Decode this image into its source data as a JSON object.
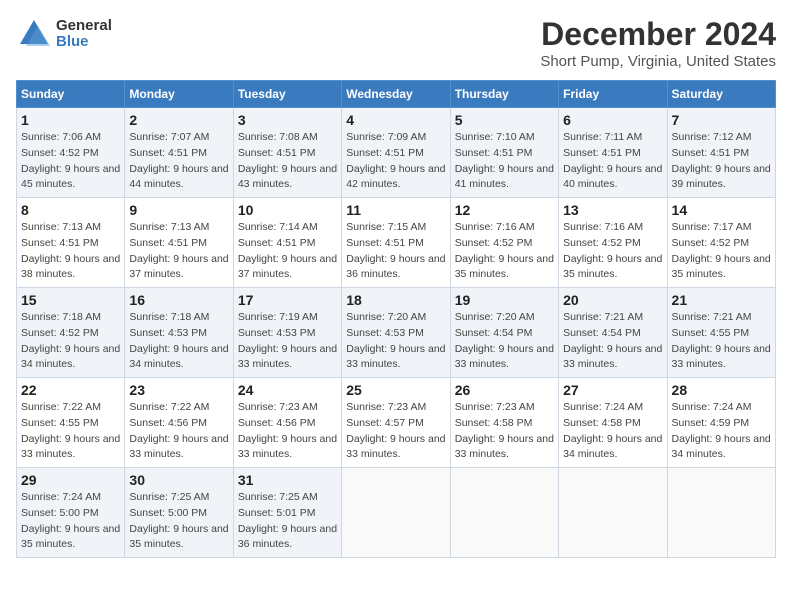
{
  "logo": {
    "general": "General",
    "blue": "Blue"
  },
  "title": "December 2024",
  "subtitle": "Short Pump, Virginia, United States",
  "days_of_week": [
    "Sunday",
    "Monday",
    "Tuesday",
    "Wednesday",
    "Thursday",
    "Friday",
    "Saturday"
  ],
  "weeks": [
    [
      {
        "day": "1",
        "sunrise": "Sunrise: 7:06 AM",
        "sunset": "Sunset: 4:52 PM",
        "daylight": "Daylight: 9 hours and 45 minutes."
      },
      {
        "day": "2",
        "sunrise": "Sunrise: 7:07 AM",
        "sunset": "Sunset: 4:51 PM",
        "daylight": "Daylight: 9 hours and 44 minutes."
      },
      {
        "day": "3",
        "sunrise": "Sunrise: 7:08 AM",
        "sunset": "Sunset: 4:51 PM",
        "daylight": "Daylight: 9 hours and 43 minutes."
      },
      {
        "day": "4",
        "sunrise": "Sunrise: 7:09 AM",
        "sunset": "Sunset: 4:51 PM",
        "daylight": "Daylight: 9 hours and 42 minutes."
      },
      {
        "day": "5",
        "sunrise": "Sunrise: 7:10 AM",
        "sunset": "Sunset: 4:51 PM",
        "daylight": "Daylight: 9 hours and 41 minutes."
      },
      {
        "day": "6",
        "sunrise": "Sunrise: 7:11 AM",
        "sunset": "Sunset: 4:51 PM",
        "daylight": "Daylight: 9 hours and 40 minutes."
      },
      {
        "day": "7",
        "sunrise": "Sunrise: 7:12 AM",
        "sunset": "Sunset: 4:51 PM",
        "daylight": "Daylight: 9 hours and 39 minutes."
      }
    ],
    [
      {
        "day": "8",
        "sunrise": "Sunrise: 7:13 AM",
        "sunset": "Sunset: 4:51 PM",
        "daylight": "Daylight: 9 hours and 38 minutes."
      },
      {
        "day": "9",
        "sunrise": "Sunrise: 7:13 AM",
        "sunset": "Sunset: 4:51 PM",
        "daylight": "Daylight: 9 hours and 37 minutes."
      },
      {
        "day": "10",
        "sunrise": "Sunrise: 7:14 AM",
        "sunset": "Sunset: 4:51 PM",
        "daylight": "Daylight: 9 hours and 37 minutes."
      },
      {
        "day": "11",
        "sunrise": "Sunrise: 7:15 AM",
        "sunset": "Sunset: 4:51 PM",
        "daylight": "Daylight: 9 hours and 36 minutes."
      },
      {
        "day": "12",
        "sunrise": "Sunrise: 7:16 AM",
        "sunset": "Sunset: 4:52 PM",
        "daylight": "Daylight: 9 hours and 35 minutes."
      },
      {
        "day": "13",
        "sunrise": "Sunrise: 7:16 AM",
        "sunset": "Sunset: 4:52 PM",
        "daylight": "Daylight: 9 hours and 35 minutes."
      },
      {
        "day": "14",
        "sunrise": "Sunrise: 7:17 AM",
        "sunset": "Sunset: 4:52 PM",
        "daylight": "Daylight: 9 hours and 35 minutes."
      }
    ],
    [
      {
        "day": "15",
        "sunrise": "Sunrise: 7:18 AM",
        "sunset": "Sunset: 4:52 PM",
        "daylight": "Daylight: 9 hours and 34 minutes."
      },
      {
        "day": "16",
        "sunrise": "Sunrise: 7:18 AM",
        "sunset": "Sunset: 4:53 PM",
        "daylight": "Daylight: 9 hours and 34 minutes."
      },
      {
        "day": "17",
        "sunrise": "Sunrise: 7:19 AM",
        "sunset": "Sunset: 4:53 PM",
        "daylight": "Daylight: 9 hours and 33 minutes."
      },
      {
        "day": "18",
        "sunrise": "Sunrise: 7:20 AM",
        "sunset": "Sunset: 4:53 PM",
        "daylight": "Daylight: 9 hours and 33 minutes."
      },
      {
        "day": "19",
        "sunrise": "Sunrise: 7:20 AM",
        "sunset": "Sunset: 4:54 PM",
        "daylight": "Daylight: 9 hours and 33 minutes."
      },
      {
        "day": "20",
        "sunrise": "Sunrise: 7:21 AM",
        "sunset": "Sunset: 4:54 PM",
        "daylight": "Daylight: 9 hours and 33 minutes."
      },
      {
        "day": "21",
        "sunrise": "Sunrise: 7:21 AM",
        "sunset": "Sunset: 4:55 PM",
        "daylight": "Daylight: 9 hours and 33 minutes."
      }
    ],
    [
      {
        "day": "22",
        "sunrise": "Sunrise: 7:22 AM",
        "sunset": "Sunset: 4:55 PM",
        "daylight": "Daylight: 9 hours and 33 minutes."
      },
      {
        "day": "23",
        "sunrise": "Sunrise: 7:22 AM",
        "sunset": "Sunset: 4:56 PM",
        "daylight": "Daylight: 9 hours and 33 minutes."
      },
      {
        "day": "24",
        "sunrise": "Sunrise: 7:23 AM",
        "sunset": "Sunset: 4:56 PM",
        "daylight": "Daylight: 9 hours and 33 minutes."
      },
      {
        "day": "25",
        "sunrise": "Sunrise: 7:23 AM",
        "sunset": "Sunset: 4:57 PM",
        "daylight": "Daylight: 9 hours and 33 minutes."
      },
      {
        "day": "26",
        "sunrise": "Sunrise: 7:23 AM",
        "sunset": "Sunset: 4:58 PM",
        "daylight": "Daylight: 9 hours and 33 minutes."
      },
      {
        "day": "27",
        "sunrise": "Sunrise: 7:24 AM",
        "sunset": "Sunset: 4:58 PM",
        "daylight": "Daylight: 9 hours and 34 minutes."
      },
      {
        "day": "28",
        "sunrise": "Sunrise: 7:24 AM",
        "sunset": "Sunset: 4:59 PM",
        "daylight": "Daylight: 9 hours and 34 minutes."
      }
    ],
    [
      {
        "day": "29",
        "sunrise": "Sunrise: 7:24 AM",
        "sunset": "Sunset: 5:00 PM",
        "daylight": "Daylight: 9 hours and 35 minutes."
      },
      {
        "day": "30",
        "sunrise": "Sunrise: 7:25 AM",
        "sunset": "Sunset: 5:00 PM",
        "daylight": "Daylight: 9 hours and 35 minutes."
      },
      {
        "day": "31",
        "sunrise": "Sunrise: 7:25 AM",
        "sunset": "Sunset: 5:01 PM",
        "daylight": "Daylight: 9 hours and 36 minutes."
      },
      null,
      null,
      null,
      null
    ]
  ]
}
